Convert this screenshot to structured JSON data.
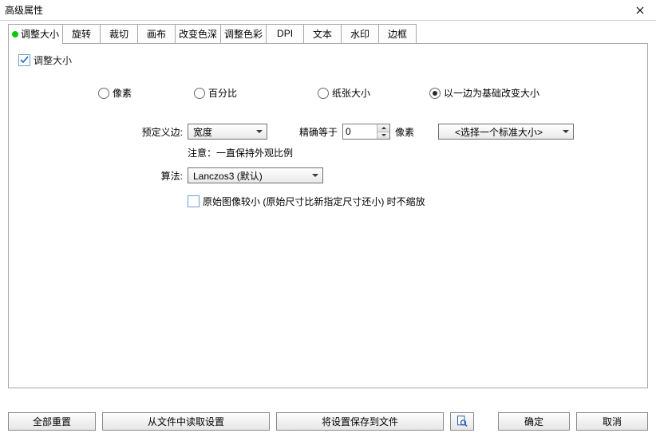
{
  "window": {
    "title": "高级属性"
  },
  "tabs": [
    {
      "label": "调整大小",
      "active": true,
      "indicator": true
    },
    {
      "label": "旋转"
    },
    {
      "label": "裁切"
    },
    {
      "label": "画布"
    },
    {
      "label": "改变色深"
    },
    {
      "label": "调整色彩"
    },
    {
      "label": "DPI"
    },
    {
      "label": "文本"
    },
    {
      "label": "水印"
    },
    {
      "label": "边框"
    }
  ],
  "resize": {
    "checkbox_label": "调整大小",
    "checkbox_checked": true,
    "radios": {
      "pixel": "像素",
      "percent": "百分比",
      "paper": "纸张大小",
      "side_based": "以一边为基础改变大小",
      "selected": "side_based"
    },
    "predefine_label": "预定义边:",
    "predefine_value": "宽度",
    "exact_label": "精确等于",
    "exact_value": "0",
    "exact_unit": "像素",
    "standard_size_value": "<选择一个标准大小>",
    "note": "注意：一直保持外观比例",
    "algorithm_label": "算法:",
    "algorithm_value": "Lanczos3 (默认)",
    "no_enlarge_checkbox_label": "原始图像较小 (原始尺寸比新指定尺寸还小) 时不缩放",
    "no_enlarge_checked": false
  },
  "footer": {
    "reset_all": "全部重置",
    "load_from_file": "从文件中读取设置",
    "save_to_file": "将设置保存到文件",
    "ok": "确定",
    "cancel": "取消"
  }
}
